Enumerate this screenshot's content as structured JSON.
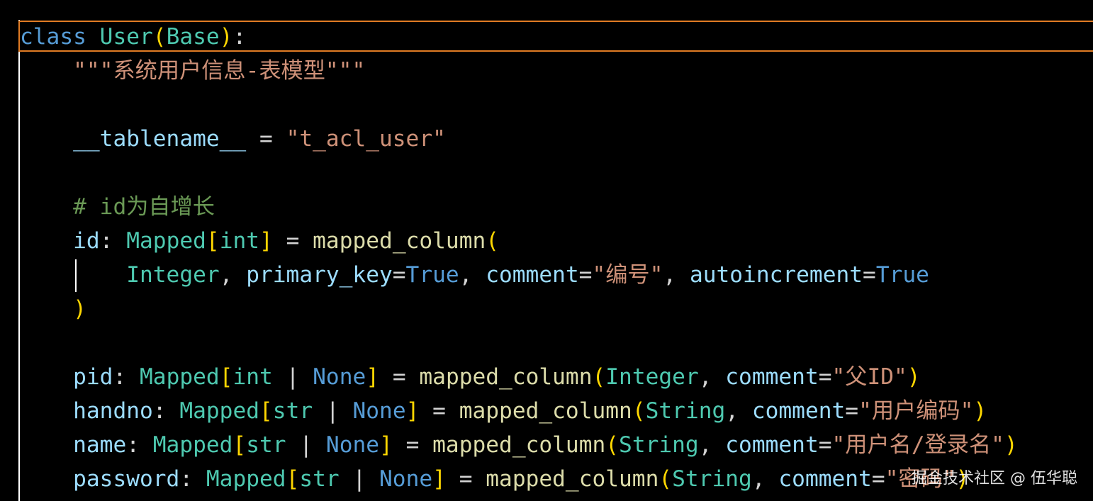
{
  "colors": {
    "background": "#000000",
    "current_line_border": "#e07b24",
    "default": "#d4d4d4",
    "keyword": "#569cd6",
    "class_name": "#4ec9b0",
    "bracket_1": "#ffd700",
    "bracket_2": "#da70d6",
    "string": "#ce9178",
    "comment": "#6a9955",
    "variable": "#9cdcfe",
    "function": "#dcdcaa",
    "operator": "#d4d4d4"
  },
  "code": {
    "lines": [
      [
        {
          "t": "class",
          "c": "keyword"
        },
        {
          "t": " ",
          "c": "default"
        },
        {
          "t": "User",
          "c": "class_name"
        },
        {
          "t": "(",
          "c": "bracket_1"
        },
        {
          "t": "Base",
          "c": "class_name"
        },
        {
          "t": ")",
          "c": "bracket_1"
        },
        {
          "t": ":",
          "c": "default"
        }
      ],
      [
        {
          "t": "    ",
          "c": "default"
        },
        {
          "t": "\"\"\"系统用户信息-表模型\"\"\"",
          "c": "string"
        }
      ],
      [],
      [
        {
          "t": "    ",
          "c": "default"
        },
        {
          "t": "__tablename__",
          "c": "variable"
        },
        {
          "t": " = ",
          "c": "operator"
        },
        {
          "t": "\"t_acl_user\"",
          "c": "string"
        }
      ],
      [],
      [
        {
          "t": "    ",
          "c": "default"
        },
        {
          "t": "# id为自增长",
          "c": "comment"
        }
      ],
      [
        {
          "t": "    ",
          "c": "default"
        },
        {
          "t": "id",
          "c": "variable"
        },
        {
          "t": ": ",
          "c": "default"
        },
        {
          "t": "Mapped",
          "c": "class_name"
        },
        {
          "t": "[",
          "c": "bracket_1"
        },
        {
          "t": "int",
          "c": "class_name"
        },
        {
          "t": "]",
          "c": "bracket_1"
        },
        {
          "t": " = ",
          "c": "operator"
        },
        {
          "t": "mapped_column",
          "c": "function"
        },
        {
          "t": "(",
          "c": "bracket_1"
        }
      ],
      [
        {
          "t": "        ",
          "c": "default"
        },
        {
          "t": "Integer",
          "c": "class_name"
        },
        {
          "t": ", ",
          "c": "default"
        },
        {
          "t": "primary_key",
          "c": "variable"
        },
        {
          "t": "=",
          "c": "operator"
        },
        {
          "t": "True",
          "c": "keyword"
        },
        {
          "t": ", ",
          "c": "default"
        },
        {
          "t": "comment",
          "c": "variable"
        },
        {
          "t": "=",
          "c": "operator"
        },
        {
          "t": "\"编号\"",
          "c": "string"
        },
        {
          "t": ", ",
          "c": "default"
        },
        {
          "t": "autoincrement",
          "c": "variable"
        },
        {
          "t": "=",
          "c": "operator"
        },
        {
          "t": "True",
          "c": "keyword"
        }
      ],
      [
        {
          "t": "    ",
          "c": "default"
        },
        {
          "t": ")",
          "c": "bracket_1"
        }
      ],
      [],
      [
        {
          "t": "    ",
          "c": "default"
        },
        {
          "t": "pid",
          "c": "variable"
        },
        {
          "t": ": ",
          "c": "default"
        },
        {
          "t": "Mapped",
          "c": "class_name"
        },
        {
          "t": "[",
          "c": "bracket_1"
        },
        {
          "t": "int",
          "c": "class_name"
        },
        {
          "t": " | ",
          "c": "operator"
        },
        {
          "t": "None",
          "c": "keyword"
        },
        {
          "t": "]",
          "c": "bracket_1"
        },
        {
          "t": " = ",
          "c": "operator"
        },
        {
          "t": "mapped_column",
          "c": "function"
        },
        {
          "t": "(",
          "c": "bracket_1"
        },
        {
          "t": "Integer",
          "c": "class_name"
        },
        {
          "t": ", ",
          "c": "default"
        },
        {
          "t": "comment",
          "c": "variable"
        },
        {
          "t": "=",
          "c": "operator"
        },
        {
          "t": "\"父ID\"",
          "c": "string"
        },
        {
          "t": ")",
          "c": "bracket_1"
        }
      ],
      [
        {
          "t": "    ",
          "c": "default"
        },
        {
          "t": "handno",
          "c": "variable"
        },
        {
          "t": ": ",
          "c": "default"
        },
        {
          "t": "Mapped",
          "c": "class_name"
        },
        {
          "t": "[",
          "c": "bracket_1"
        },
        {
          "t": "str",
          "c": "class_name"
        },
        {
          "t": " | ",
          "c": "operator"
        },
        {
          "t": "None",
          "c": "keyword"
        },
        {
          "t": "]",
          "c": "bracket_1"
        },
        {
          "t": " = ",
          "c": "operator"
        },
        {
          "t": "mapped_column",
          "c": "function"
        },
        {
          "t": "(",
          "c": "bracket_1"
        },
        {
          "t": "String",
          "c": "class_name"
        },
        {
          "t": ", ",
          "c": "default"
        },
        {
          "t": "comment",
          "c": "variable"
        },
        {
          "t": "=",
          "c": "operator"
        },
        {
          "t": "\"用户编码\"",
          "c": "string"
        },
        {
          "t": ")",
          "c": "bracket_1"
        }
      ],
      [
        {
          "t": "    ",
          "c": "default"
        },
        {
          "t": "name",
          "c": "variable"
        },
        {
          "t": ": ",
          "c": "default"
        },
        {
          "t": "Mapped",
          "c": "class_name"
        },
        {
          "t": "[",
          "c": "bracket_1"
        },
        {
          "t": "str",
          "c": "class_name"
        },
        {
          "t": " | ",
          "c": "operator"
        },
        {
          "t": "None",
          "c": "keyword"
        },
        {
          "t": "]",
          "c": "bracket_1"
        },
        {
          "t": " = ",
          "c": "operator"
        },
        {
          "t": "mapped_column",
          "c": "function"
        },
        {
          "t": "(",
          "c": "bracket_1"
        },
        {
          "t": "String",
          "c": "class_name"
        },
        {
          "t": ", ",
          "c": "default"
        },
        {
          "t": "comment",
          "c": "variable"
        },
        {
          "t": "=",
          "c": "operator"
        },
        {
          "t": "\"用户名/登录名\"",
          "c": "string"
        },
        {
          "t": ")",
          "c": "bracket_1"
        }
      ],
      [
        {
          "t": "    ",
          "c": "default"
        },
        {
          "t": "password",
          "c": "variable"
        },
        {
          "t": ": ",
          "c": "default"
        },
        {
          "t": "Mapped",
          "c": "class_name"
        },
        {
          "t": "[",
          "c": "bracket_1"
        },
        {
          "t": "str",
          "c": "class_name"
        },
        {
          "t": " | ",
          "c": "operator"
        },
        {
          "t": "None",
          "c": "keyword"
        },
        {
          "t": "]",
          "c": "bracket_1"
        },
        {
          "t": " = ",
          "c": "operator"
        },
        {
          "t": "mapped_column",
          "c": "function"
        },
        {
          "t": "(",
          "c": "bracket_1"
        },
        {
          "t": "String",
          "c": "class_name"
        },
        {
          "t": ", ",
          "c": "default"
        },
        {
          "t": "comment",
          "c": "variable"
        },
        {
          "t": "=",
          "c": "operator"
        },
        {
          "t": "\"密码\"",
          "c": "string"
        },
        {
          "t": ")",
          "c": "bracket_1"
        }
      ]
    ]
  },
  "watermark": {
    "text": "掘金技术社区 @ 伍华聪"
  }
}
